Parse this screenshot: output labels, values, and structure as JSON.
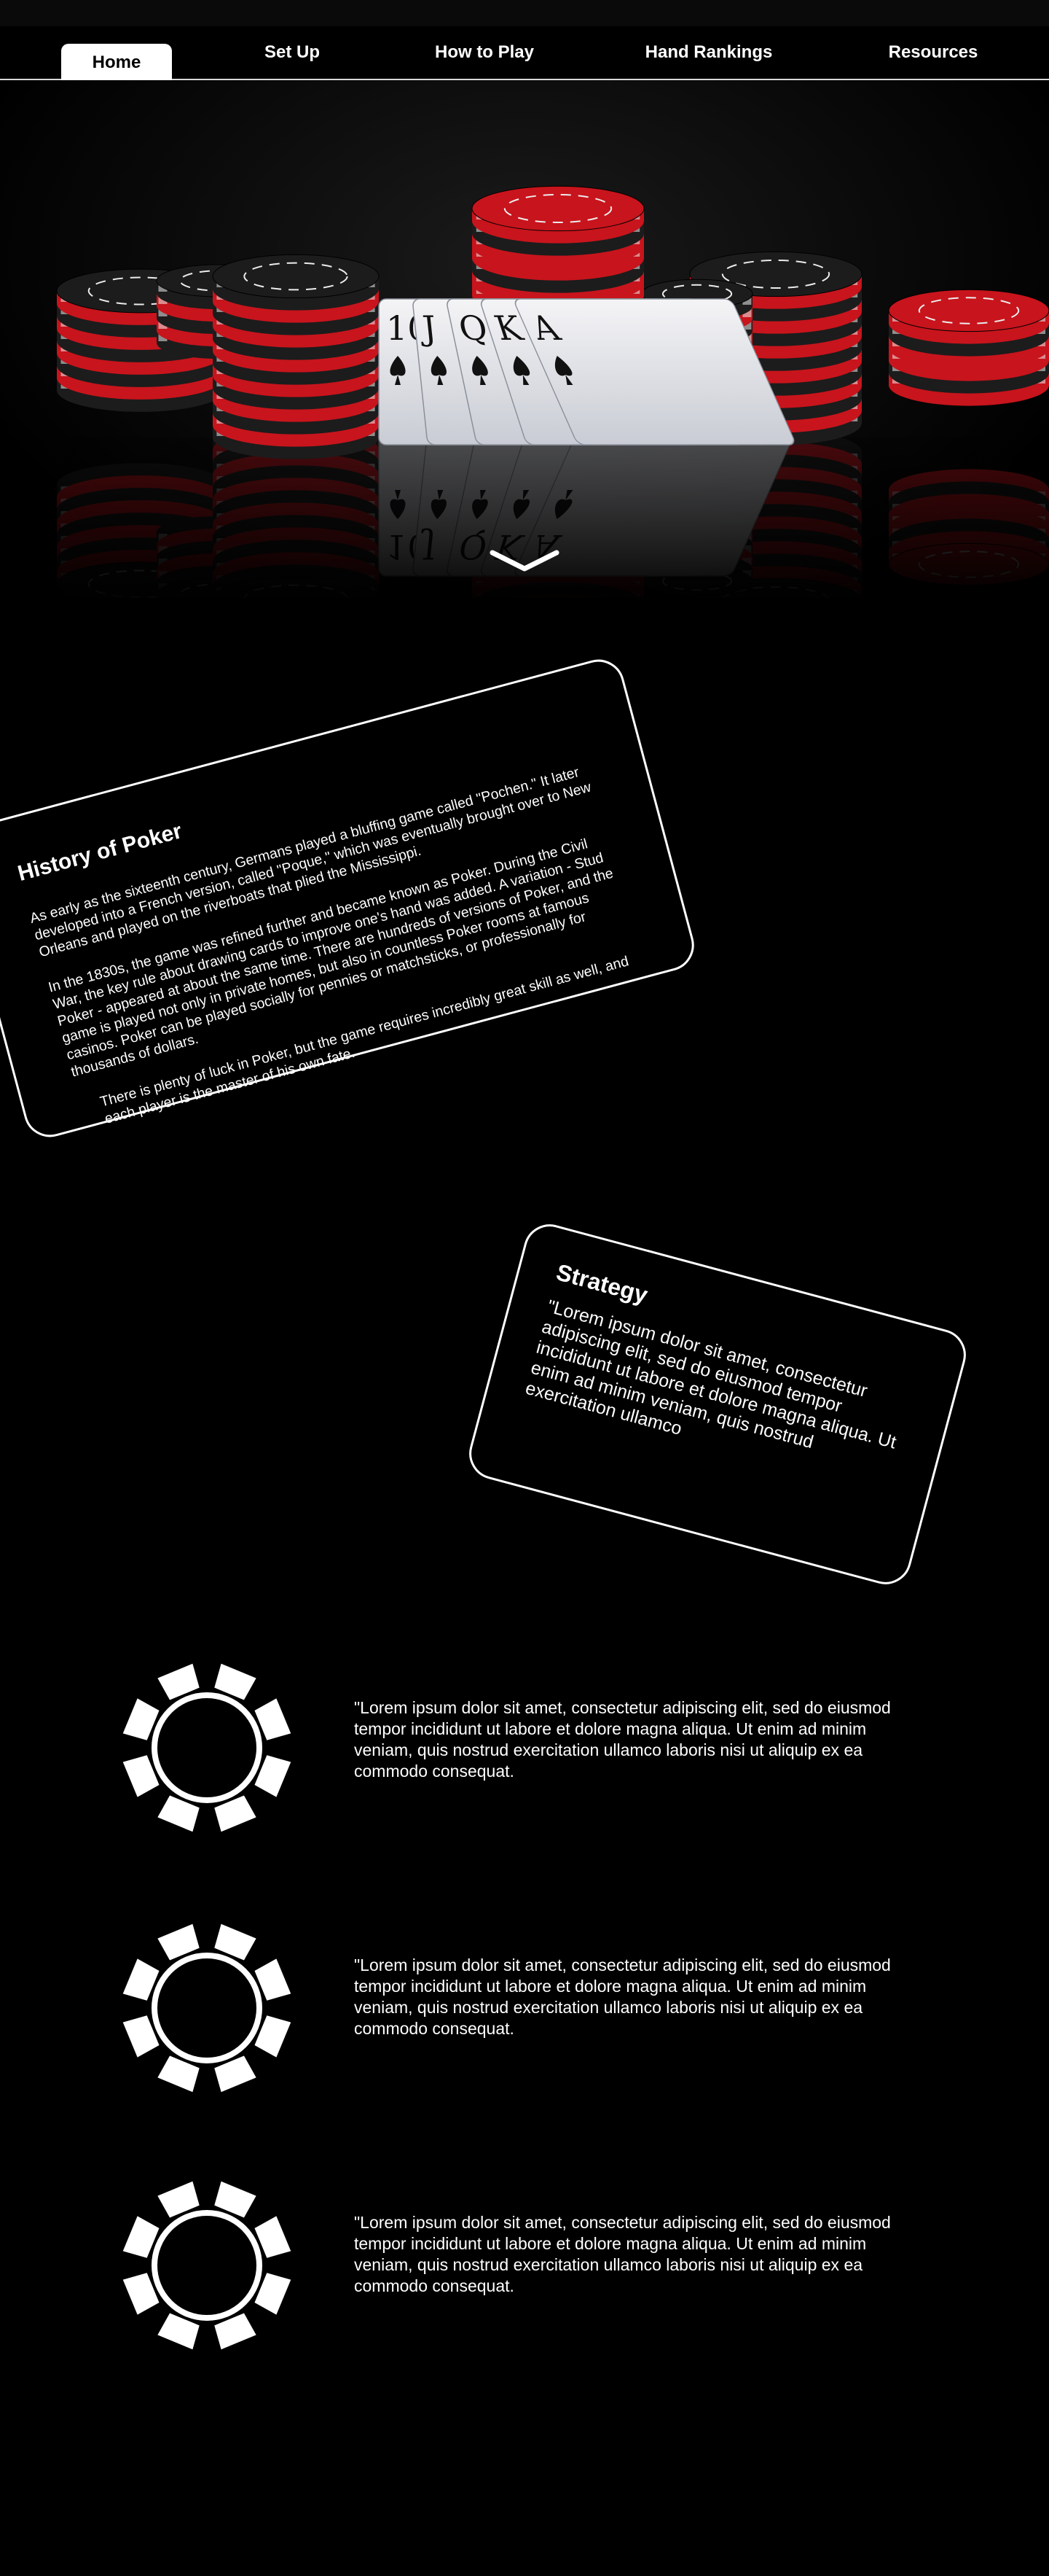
{
  "nav": {
    "items": [
      {
        "label": "Home",
        "active": true
      },
      {
        "label": "Set Up",
        "active": false
      },
      {
        "label": "How to Play",
        "active": false
      },
      {
        "label": "Hand Rankings",
        "active": false
      },
      {
        "label": "Resources",
        "active": false
      }
    ]
  },
  "hero": {
    "icons": {
      "scroll": "chevron-down-icon"
    }
  },
  "history": {
    "title": "History of Poker",
    "paragraphs": [
      "As early as the sixteenth century, Germans played a bluffing game called \"Pochen.\" It later developed into a French version, called \"Poque,\" which was eventually brought over to New Orleans and played on the riverboats that plied the Mississippi.",
      "In the 1830s, the game was refined further and became known as Poker. During the Civil War, the key rule about drawing cards to improve one's hand was added. A variation - Stud Poker - appeared at about the same time. There are hundreds of versions of Poker, and the game is played not only in private homes, but also in countless Poker rooms at famous casinos. Poker can be played socially for pennies or matchsticks, or professionally for thousands of dollars.",
      "There is plenty of luck in Poker, but the game requires incredibly great skill as well, and each player is the master of his own fate."
    ]
  },
  "strategy": {
    "title": "Strategy",
    "text": "\"Lorem ipsum dolor sit amet, consectetur adipiscing elit, sed do eiusmod tempor incididunt ut labore et dolore magna aliqua. Ut enim ad minim veniam, quis nostrud exercitation ullamco"
  },
  "features": [
    {
      "icon": "poker-chip-icon",
      "text": "\"Lorem ipsum dolor sit amet, consectetur adipiscing elit, sed do eiusmod tempor incididunt ut labore et dolore magna aliqua. Ut enim ad minim veniam, quis nostrud exercitation ullamco laboris nisi ut aliquip ex ea commodo consequat."
    },
    {
      "icon": "poker-chip-icon",
      "text": "\"Lorem ipsum dolor sit amet, consectetur adipiscing elit, sed do eiusmod tempor incididunt ut labore et dolore magna aliqua. Ut enim ad minim veniam, quis nostrud exercitation ullamco laboris nisi ut aliquip ex ea commodo consequat."
    },
    {
      "icon": "poker-chip-icon",
      "text": "\"Lorem ipsum dolor sit amet, consectetur adipiscing elit, sed do eiusmod tempor incididunt ut labore et dolore magna aliqua. Ut enim ad minim veniam, quis nostrud exercitation ullamco laboris nisi ut aliquip ex ea commodo consequat."
    }
  ],
  "hero_cards": [
    "10",
    "J",
    "Q",
    "K",
    "A"
  ],
  "colors": {
    "background": "#000000",
    "text": "#ffffff",
    "chip_red": "#c8141c",
    "chip_black": "#1c1c1c",
    "chip_white": "#ececec"
  }
}
